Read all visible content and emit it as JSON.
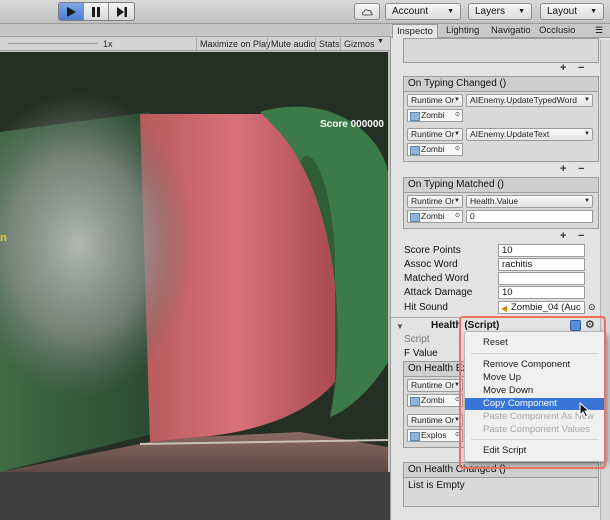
{
  "toolbar": {
    "cloud_icon": "cloud-icon",
    "account_label": "Account",
    "layers_label": "Layers",
    "layout_label": "Layout"
  },
  "game": {
    "scale_label": "1x",
    "maximize_on_play": "Maximize on Play",
    "mute_audio": "Mute audio",
    "stats": "Stats",
    "gizmos": "Gizmos",
    "score_text": "Score 000000",
    "partial_word": "n"
  },
  "tabs": [
    {
      "label": "Inspecto"
    },
    {
      "label": "Lighting"
    },
    {
      "label": "Navigatio"
    },
    {
      "label": "Occlusio"
    }
  ],
  "inspector": {
    "on_typing_changed": {
      "title": "On Typing Changed ()",
      "rows": [
        {
          "mode": "Runtime Or",
          "function": "AIEnemy.UpdateTypedWord",
          "object": "Zombi",
          "arg": ""
        },
        {
          "mode": "Runtime Or",
          "function": "AIEnemy.UpdateText",
          "object": "Zombi",
          "arg": ""
        }
      ]
    },
    "on_typing_matched": {
      "title": "On Typing Matched ()",
      "rows": [
        {
          "mode": "Runtime Or",
          "function": "Health.Value",
          "object": "Zombi",
          "arg": "0"
        }
      ]
    },
    "props": [
      {
        "label": "Score Points",
        "value": "10"
      },
      {
        "label": "Assoc Word",
        "value": "rachitis"
      },
      {
        "label": "Matched Word",
        "value": ""
      },
      {
        "label": "Attack Damage",
        "value": "10"
      },
      {
        "label": "Hit Sound",
        "value": "Zombie_04 (Auc"
      }
    ],
    "health": {
      "title": "Health (Script)",
      "script_label": "Script",
      "f_value_label": "F Value",
      "on_health_label": "On Health Ex",
      "row1_mode": "Runtime Or",
      "row1_object": "Zombi",
      "row2_mode": "Runtime Or",
      "row2_object": "Explos",
      "on_health_changed": "On Health Changed ()",
      "list_empty": "List is Empty"
    }
  },
  "context_menu": {
    "items": [
      {
        "label": "Reset",
        "state": "enabled"
      },
      {
        "label": "Remove Component",
        "state": "enabled"
      },
      {
        "label": "Move Up",
        "state": "enabled"
      },
      {
        "label": "Move Down",
        "state": "enabled"
      },
      {
        "label": "Copy Component",
        "state": "selected"
      },
      {
        "label": "Paste Component As New",
        "state": "disabled"
      },
      {
        "label": "Paste Component Values",
        "state": "disabled"
      },
      {
        "label": "Edit Script",
        "state": "enabled"
      }
    ]
  },
  "colors": {
    "highlight_border": "#f26f5f",
    "menu_selection": "#3875d7",
    "play_active": "#4b7dd1"
  }
}
